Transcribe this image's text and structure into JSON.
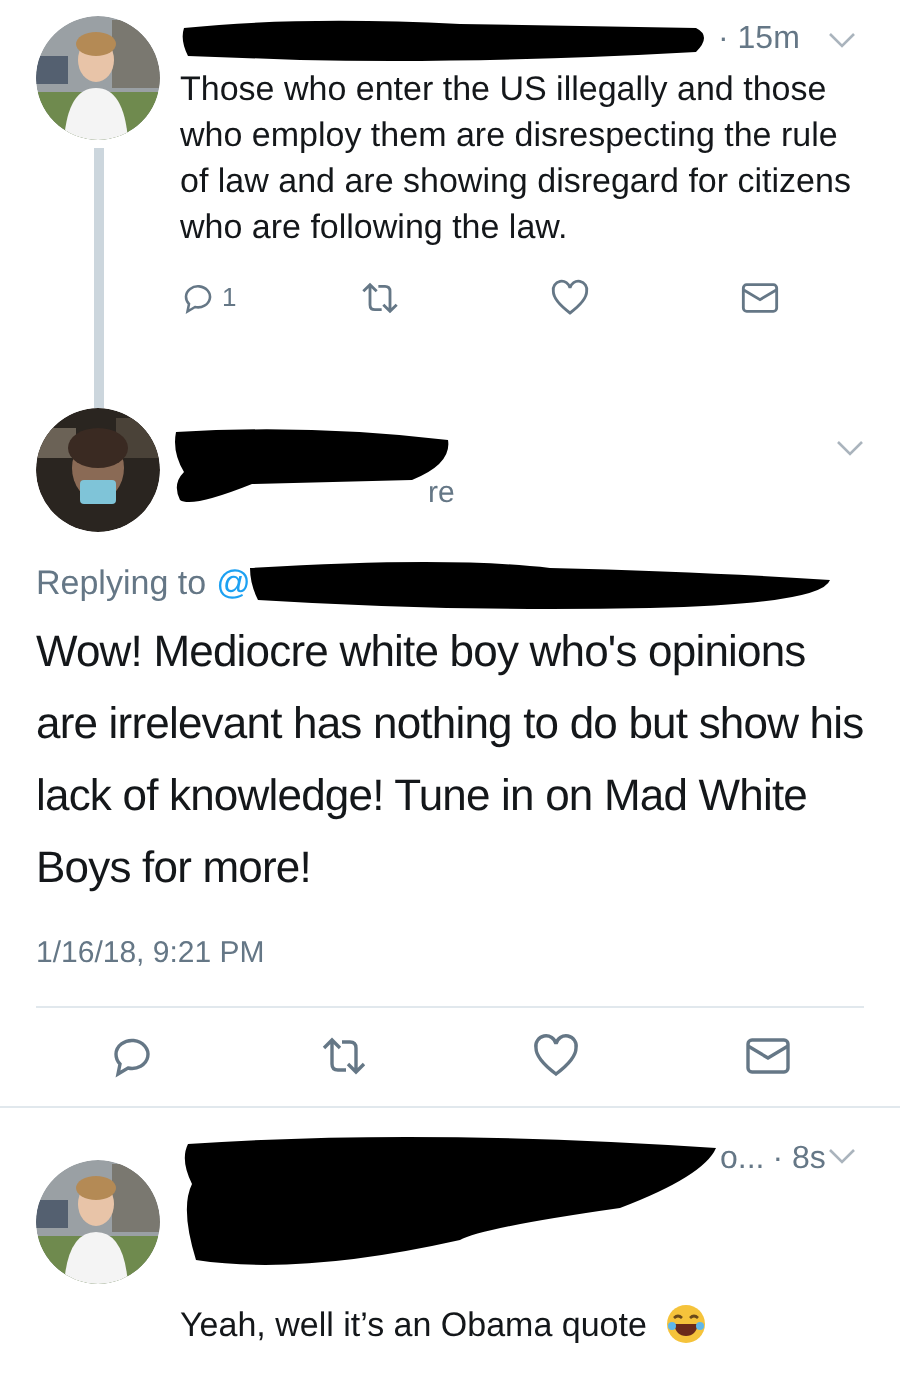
{
  "thread_tweet": {
    "time": "· 15m",
    "text": "Those who enter the US illegally and those who employ them are disrespecting the rule of law and are showing disregard for citizens who are following the law.",
    "reply_count": "1"
  },
  "focused_tweet": {
    "handle_fragment": "re",
    "replying_label": "Replying to",
    "replying_at": "@",
    "text": "Wow! Mediocre white boy who's opinions are irrelevant has nothing to do but show his lack of knowledge! Tune in on Mad White Boys for more!",
    "date": "1/16/18, 9:21 PM"
  },
  "reply_tweet": {
    "name_fragment": "o...",
    "time": "· 8s",
    "text": "Yeah, well it’s an Obama quote"
  }
}
